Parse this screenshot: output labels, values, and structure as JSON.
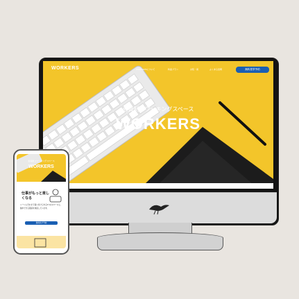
{
  "site": {
    "logo": "WORKERS",
    "nav_links": [
      "WORKERSについて",
      "料金プラン",
      "お知・報",
      "よくある質問"
    ],
    "cta_label": "無料見学予約",
    "hero_subtitle": "会員制コワーキングスペース",
    "hero_title": "WORKERS"
  },
  "mobile": {
    "hero_subtitle": "会員制コワーキングスペース",
    "logo": "WORKERS",
    "heading": "仕事がもっと楽しくなる",
    "body": "シーンに合わせて使い分けられる3つのスペースと、集中できる環境を用意しています。",
    "button_label": "無料見学予約"
  },
  "colors": {
    "hero_yellow": "#f3c52a",
    "accent_blue": "#1a5fb3",
    "background": "#e9e5e0"
  }
}
